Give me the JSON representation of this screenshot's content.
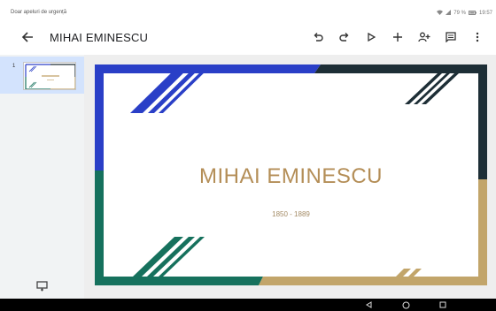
{
  "status_bar": {
    "carrier_text": "Doar apeluri de urgență",
    "battery": "79 %",
    "time": "19:57"
  },
  "app_bar": {
    "title": "MIHAI EMINESCU",
    "icons": [
      "back-arrow-icon",
      "undo-icon",
      "redo-icon",
      "play-icon",
      "add-icon",
      "share-person-icon",
      "comments-icon",
      "more-vert-icon"
    ]
  },
  "thumbnails": [
    {
      "number": "1",
      "selected": true
    }
  ],
  "slide": {
    "title": "MIHAI EMINESCU",
    "subtitle": "1850 - 1889",
    "colors": {
      "blue": "#2a3fc7",
      "dark": "#1d2e36",
      "green": "#16715d",
      "gold": "#c2a56a",
      "title": "#b48e57"
    }
  },
  "nav_bar": {
    "icons": [
      "nav-back-icon",
      "nav-home-icon",
      "nav-recents-icon"
    ]
  }
}
